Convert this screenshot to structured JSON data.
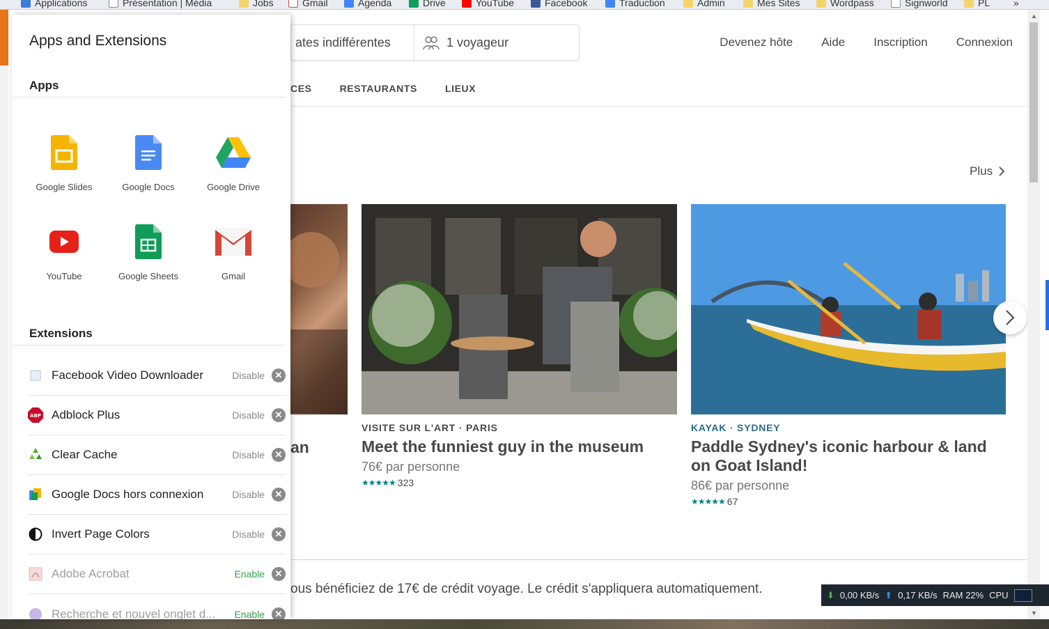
{
  "bookmarks": [
    {
      "label": "Applications",
      "color": "#3d7bd9"
    },
    {
      "label": "Présentation | Média",
      "color": "#ffffff"
    },
    {
      "label": "Jobs",
      "color": "#f5d36a"
    },
    {
      "label": "Gmail",
      "color": "#ffffff"
    },
    {
      "label": "Agenda",
      "color": "#4285f4"
    },
    {
      "label": "Drive",
      "color": "#0f9d58"
    },
    {
      "label": "YouTube",
      "color": "#ff0000"
    },
    {
      "label": "Facebook",
      "color": "#3b5998"
    },
    {
      "label": "Traduction",
      "color": "#4285f4"
    },
    {
      "label": "Admin",
      "color": "#f5d36a"
    },
    {
      "label": "Mes Sites",
      "color": "#f5d36a"
    },
    {
      "label": "Wordpass",
      "color": "#f5d36a"
    },
    {
      "label": "Signworld",
      "color": "#ffffff"
    },
    {
      "label": "PL",
      "color": "#f5d36a"
    }
  ],
  "bookmarks_overflow": "»",
  "header": {
    "dates": "ates indifférentes",
    "guests": "1 voyageur",
    "nav": [
      "Devenez hôte",
      "Aide",
      "Inscription",
      "Connexion"
    ]
  },
  "subnav": [
    "CES",
    "RESTAURANTS",
    "LIEUX"
  ],
  "plus_label": "Plus",
  "cards": {
    "partial_title": "an",
    "card1": {
      "meta": "VISITE SUR L'ART · PARIS",
      "title": "Meet the funniest guy in the museum",
      "price": "76€ par personne",
      "stars": "★★★★★",
      "reviews": "323",
      "meta_color": "#484848"
    },
    "card2": {
      "meta": "KAYAK · SYDNEY",
      "title": "Paddle Sydney's iconic harbour & land on Goat Island!",
      "price": "86€ par personne",
      "stars": "★★★★★",
      "reviews": "67",
      "meta_color": "#2a6b8a"
    }
  },
  "credit_text": "ous bénéficiez de 17€ de crédit voyage. Le crédit s'appliquera automatiquement.",
  "netmon": {
    "down": "0,00 KB/s",
    "up": "0,17 KB/s",
    "ram": "RAM 22%",
    "cpu": "CPU"
  },
  "panel": {
    "title": "Apps and Extensions",
    "apps_heading": "Apps",
    "extensions_heading": "Extensions",
    "apps": [
      {
        "label": "Google Slides",
        "icon": "google-slides-icon"
      },
      {
        "label": "Google Docs",
        "icon": "google-docs-icon"
      },
      {
        "label": "Google Drive",
        "icon": "google-drive-icon"
      },
      {
        "label": "YouTube",
        "icon": "youtube-icon"
      },
      {
        "label": "Google Sheets",
        "icon": "google-sheets-icon"
      },
      {
        "label": "Gmail",
        "icon": "gmail-icon"
      }
    ],
    "extensions": [
      {
        "name": "Facebook Video Downloader",
        "action": "Disable",
        "enabled": true,
        "icon": "facebook-video-downloader-icon"
      },
      {
        "name": "Adblock Plus",
        "action": "Disable",
        "enabled": true,
        "icon": "adblock-plus-icon"
      },
      {
        "name": "Clear Cache",
        "action": "Disable",
        "enabled": true,
        "icon": "clear-cache-icon"
      },
      {
        "name": "Google Docs hors connexion",
        "action": "Disable",
        "enabled": true,
        "icon": "google-docs-offline-icon"
      },
      {
        "name": "Invert Page Colors",
        "action": "Disable",
        "enabled": true,
        "icon": "invert-colors-icon"
      },
      {
        "name": "Adobe Acrobat",
        "action": "Enable",
        "enabled": false,
        "icon": "adobe-acrobat-icon"
      },
      {
        "name": "Recherche et nouvel onglet d...",
        "action": "Enable",
        "enabled": false,
        "icon": "search-new-tab-icon"
      }
    ],
    "adblock_badge": "ABP"
  }
}
